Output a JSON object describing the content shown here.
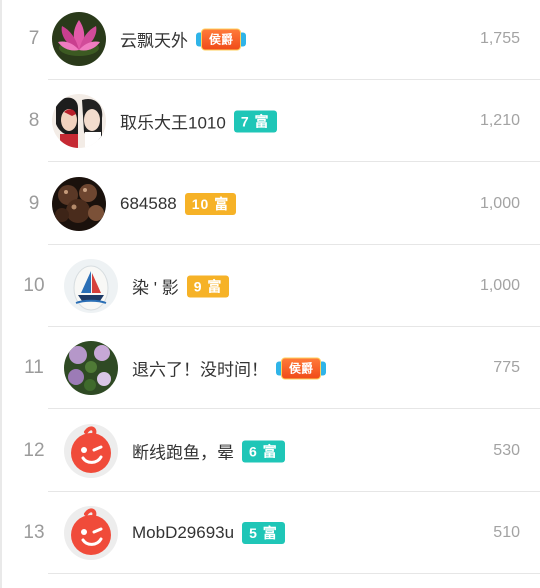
{
  "leaderboard": {
    "rows": [
      {
        "rank": "7",
        "name": "云飘天外",
        "badge": {
          "kind": "hou",
          "text": "侯爵"
        },
        "score": "1,755",
        "avatar": "lotus-flower-avatar"
      },
      {
        "rank": "8",
        "name": "取乐大王1010",
        "badge": {
          "kind": "fu",
          "text": "7 富",
          "color": "#1fc6b7"
        },
        "score": "1,210",
        "avatar": "couple-illustration-avatar"
      },
      {
        "rank": "9",
        "name": "684588",
        "badge": {
          "kind": "fu",
          "text": "10 富",
          "color": "#f6b227"
        },
        "score": "1,000",
        "avatar": "chocolate-truffles-avatar"
      },
      {
        "rank": "10",
        "name": "染 ' 影",
        "badge": {
          "kind": "fu",
          "text": "9 富",
          "color": "#f6b227"
        },
        "score": "1,000",
        "avatar": "painted-egg-sailboat-avatar"
      },
      {
        "rank": "11",
        "name": "退六了！没时间！",
        "badge": {
          "kind": "hou",
          "text": "侯爵"
        },
        "score": "775",
        "avatar": "flowers-avatar"
      },
      {
        "rank": "12",
        "name": "断线跑鱼，晕",
        "badge": {
          "kind": "fu",
          "text": "6 富",
          "color": "#1fc6b7"
        },
        "score": "530",
        "avatar": "default-wink-face-avatar"
      },
      {
        "rank": "13",
        "name": "MobD29693u",
        "badge": {
          "kind": "fu",
          "text": "5 富",
          "color": "#1fc6b7"
        },
        "score": "510",
        "avatar": "default-wink-face-avatar"
      }
    ]
  }
}
